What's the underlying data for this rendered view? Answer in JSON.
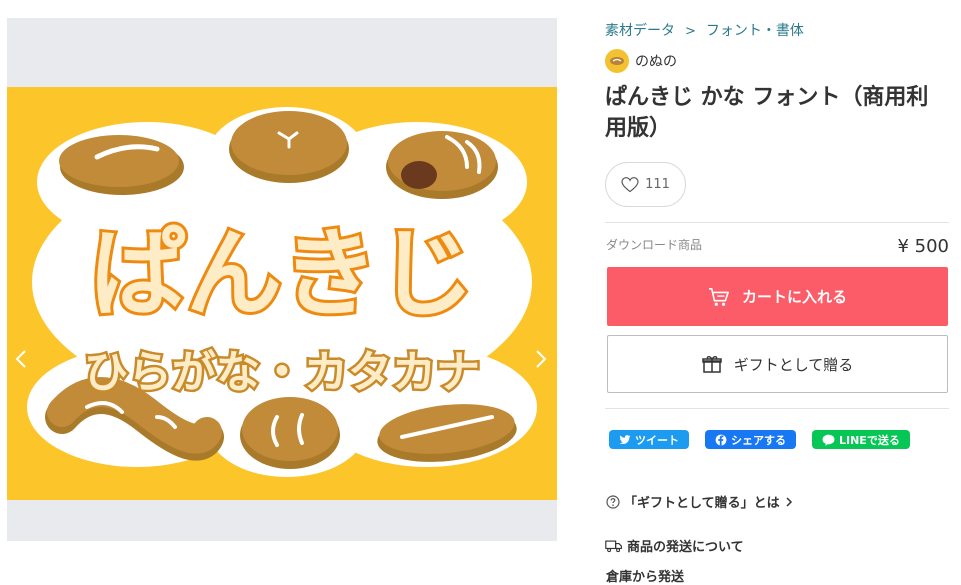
{
  "breadcrumb": [
    "素材データ",
    "フォント・書体"
  ],
  "shop": {
    "name": "のぬの",
    "avatar_icon": "bread-icon"
  },
  "product": {
    "title": "ぱんきじ かな フォント（商用利用版）",
    "likes": "111",
    "type_label": "ダウンロード商品",
    "price": "¥ 500"
  },
  "image": {
    "title_text": "ぱんきじ",
    "subtitle_text": "ひらがな・カタカナ",
    "bg_color": "#fcc62a"
  },
  "actions": {
    "cart_label": "カートに入れる",
    "gift_label": "ギフトとして贈る",
    "cart_color": "#fb5c68"
  },
  "share": {
    "twitter": "ツイート",
    "facebook": "シェアする",
    "line": "LINEで送る"
  },
  "info": {
    "gift_help": "「ギフトとして贈る」とは",
    "shipping_title": "商品の発送について",
    "shipping_sub": "倉庫から発送"
  },
  "colors": {
    "link": "#2a7a8c",
    "accent": "#fb5c68"
  }
}
